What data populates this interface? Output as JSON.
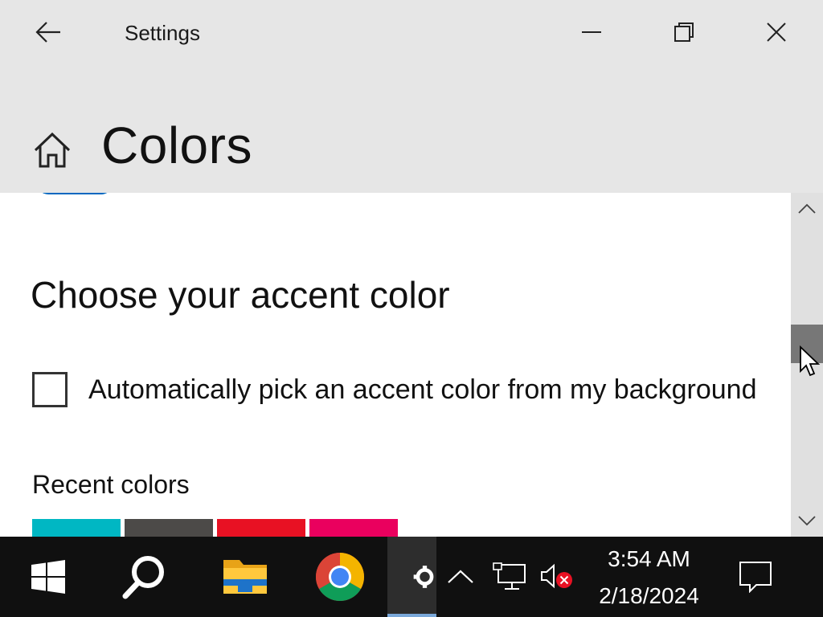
{
  "window": {
    "app_title": "Settings"
  },
  "header": {
    "page_title": "Colors"
  },
  "content": {
    "section_title": "Choose your accent color",
    "auto_pick_label": "Automatically pick an accent color from my background",
    "auto_pick_checked": false,
    "recent_colors_label": "Recent colors",
    "recent_colors": [
      "#00b7c3",
      "#4c4a48",
      "#e81123",
      "#ea005e"
    ]
  },
  "colors": {
    "accent": "#0067c0",
    "titlebar_bg": "#e6e6e6",
    "content_bg": "#ffffff",
    "taskbar_bg": "#101010"
  },
  "taskbar": {
    "items": [
      "start-button",
      "search-icon",
      "file-explorer-icon",
      "chrome-icon",
      "settings-icon"
    ],
    "tray_icons": [
      "show-hidden-icons-chevron",
      "network-icon",
      "volume-muted-icon"
    ],
    "time": "3:54 AM",
    "date": "2/18/2024",
    "notification_icon": "action-center-icon"
  }
}
